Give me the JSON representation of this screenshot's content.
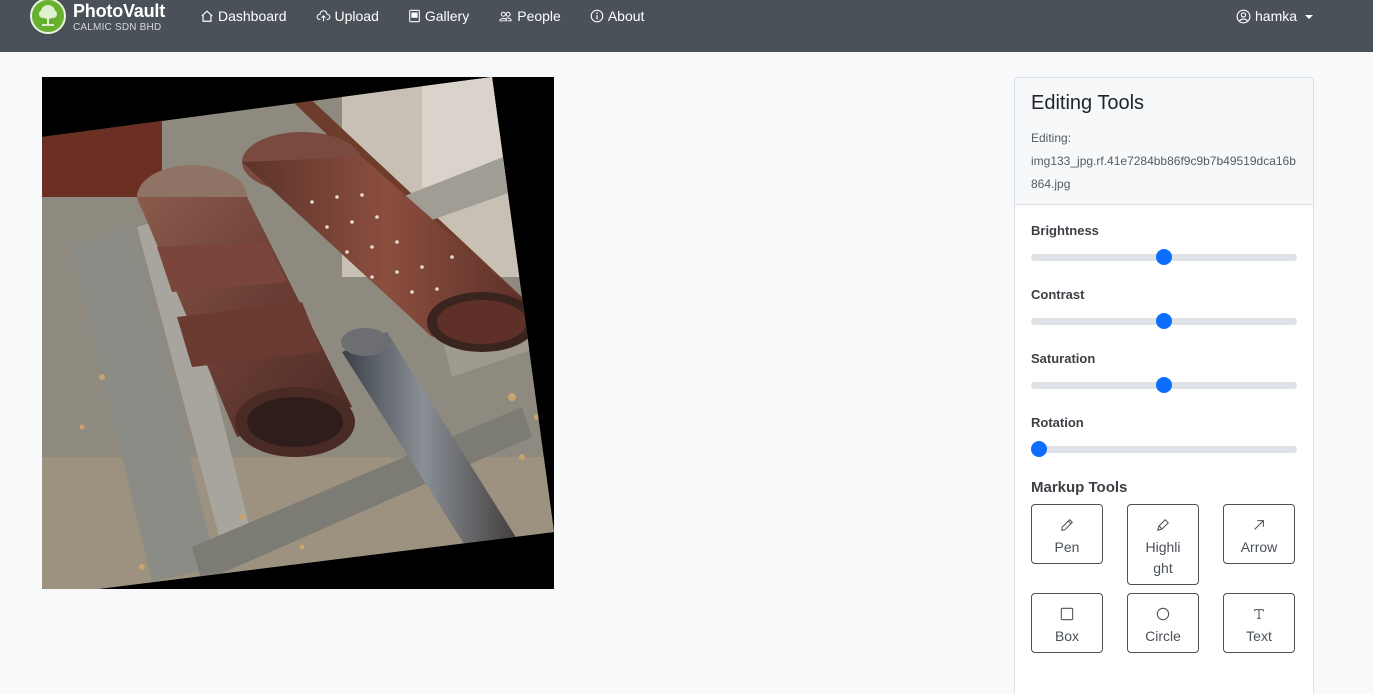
{
  "brand": {
    "name": "PhotoVault",
    "subtitle": "CALMIC SDN BHD"
  },
  "nav": {
    "items": [
      {
        "label": "Dashboard",
        "icon": "house-icon"
      },
      {
        "label": "Upload",
        "icon": "cloud-upload-icon"
      },
      {
        "label": "Gallery",
        "icon": "image-icon"
      },
      {
        "label": "People",
        "icon": "people-icon"
      },
      {
        "label": "About",
        "icon": "info-circle-icon"
      }
    ],
    "user": {
      "label": "hamka",
      "icon": "person-circle-icon"
    }
  },
  "editor": {
    "title": "Editing Tools",
    "editing_label": "Editing:",
    "filename": "img133_jpg.rf.41e7284bb86f9c9b7b49519dca16b864.jpg",
    "sliders": [
      {
        "label": "Brightness",
        "value": 0.5
      },
      {
        "label": "Contrast",
        "value": 0.5
      },
      {
        "label": "Saturation",
        "value": 0.5
      },
      {
        "label": "Rotation",
        "value": 0.0
      }
    ],
    "markup_title": "Markup Tools",
    "tools": [
      {
        "label": "Pen",
        "icon": "pencil-icon"
      },
      {
        "label": "Highlight",
        "icon": "highlighter-icon"
      },
      {
        "label": "Arrow",
        "icon": "arrow-up-right-icon"
      },
      {
        "label": "Box",
        "icon": "square-icon"
      },
      {
        "label": "Circle",
        "icon": "circle-icon"
      },
      {
        "label": "Text",
        "icon": "text-icon"
      }
    ]
  },
  "colors": {
    "navbar": "#4b5158",
    "accent": "#0d6efd",
    "logo": "#67b12f"
  }
}
